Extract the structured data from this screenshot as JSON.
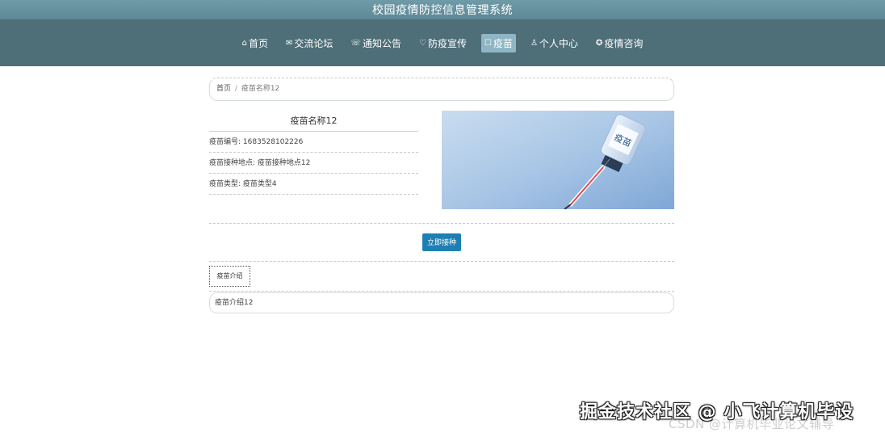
{
  "header": {
    "title": "校园疫情防控信息管理系统"
  },
  "nav": {
    "items": [
      {
        "icon": "⌂",
        "icon_name": "home-icon",
        "label": "首页"
      },
      {
        "icon": "✉",
        "icon_name": "message-icon",
        "label": "交流论坛"
      },
      {
        "icon": "☏",
        "icon_name": "notice-icon",
        "label": "通知公告"
      },
      {
        "icon": "♡",
        "icon_name": "shield-icon",
        "label": "防疫宣传"
      },
      {
        "icon": "☐",
        "icon_name": "vaccine-icon",
        "label": "疫苗"
      },
      {
        "icon": "♙",
        "icon_name": "user-icon",
        "label": "个人中心"
      },
      {
        "icon": "✪",
        "icon_name": "consult-icon",
        "label": "疫情咨询"
      }
    ],
    "active_index": 4
  },
  "breadcrumb": {
    "home": "首页",
    "separator": "/",
    "current": "疫苗名称12"
  },
  "detail": {
    "name": "疫苗名称12",
    "rows": [
      {
        "label": "疫苗编号:",
        "value": "1683528102226"
      },
      {
        "label": "疫苗接种地点:",
        "value": "疫苗接种地点12"
      },
      {
        "label": "疫苗类型:",
        "value": "疫苗类型4"
      }
    ],
    "image_label": "疫苗"
  },
  "actions": {
    "book_label": "立即接种"
  },
  "intro": {
    "tab_label": "疫苗介绍",
    "content": "疫苗介绍12"
  },
  "watermark": {
    "line1": "掘金技术社区 @ 小飞计算机毕设",
    "line2": "CSDN @计算机毕业论文辅导"
  },
  "colors": {
    "nav_bg": "#4e6e78",
    "header_bg": "#6f9aa8",
    "active_tab": "#8eb6c4",
    "button": "#1d7fb3"
  }
}
